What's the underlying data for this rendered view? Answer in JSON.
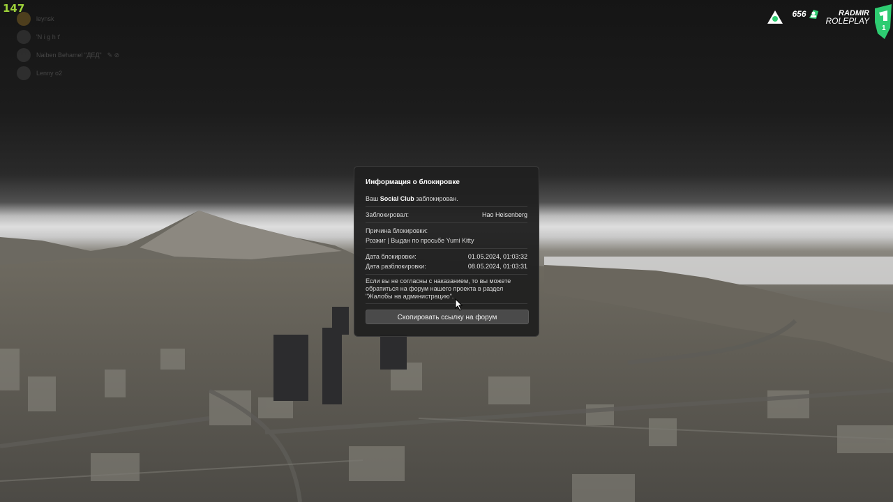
{
  "hud": {
    "fps": "147"
  },
  "voice_chat": {
    "users": [
      {
        "name": "leynsk",
        "extra": ""
      },
      {
        "name": "'N i g h t'",
        "extra": ""
      },
      {
        "name": "Naiben Behamel \"ДЕД\"",
        "extra": "✎ ⊘"
      },
      {
        "name": "Lenny o2",
        "extra": ""
      }
    ]
  },
  "server_brand": {
    "online_count": "656",
    "logo_line1": "RADMIR",
    "logo_line2": "ROLEPLAY",
    "server_number": "1",
    "accent_color": "#2ecc71"
  },
  "ban_dialog": {
    "title": "Информация о блокировке",
    "notice_prefix": "Ваш",
    "notice_bold": "Social Club",
    "notice_suffix": "заблокирован.",
    "blocked_by_label": "Заблокировал:",
    "blocked_by_value": "Hao Heisenberg",
    "reason_label": "Причина блокировки:",
    "reason_value": "Розжиг | Выдан по просьбе Yumi Kitty",
    "ban_date_label": "Дата блокировки:",
    "ban_date_value": "01.05.2024, 01:03:32",
    "unban_date_label": "Дата разблокировки:",
    "unban_date_value": "08.05.2024, 01:03:31",
    "appeal_text": "Если вы не согласны с наказанием, то вы можете обратиться на форум нашего проекта в раздел \"Жалобы на администрацию\".",
    "copy_button_label": "Скопировать ссылку на форум"
  }
}
